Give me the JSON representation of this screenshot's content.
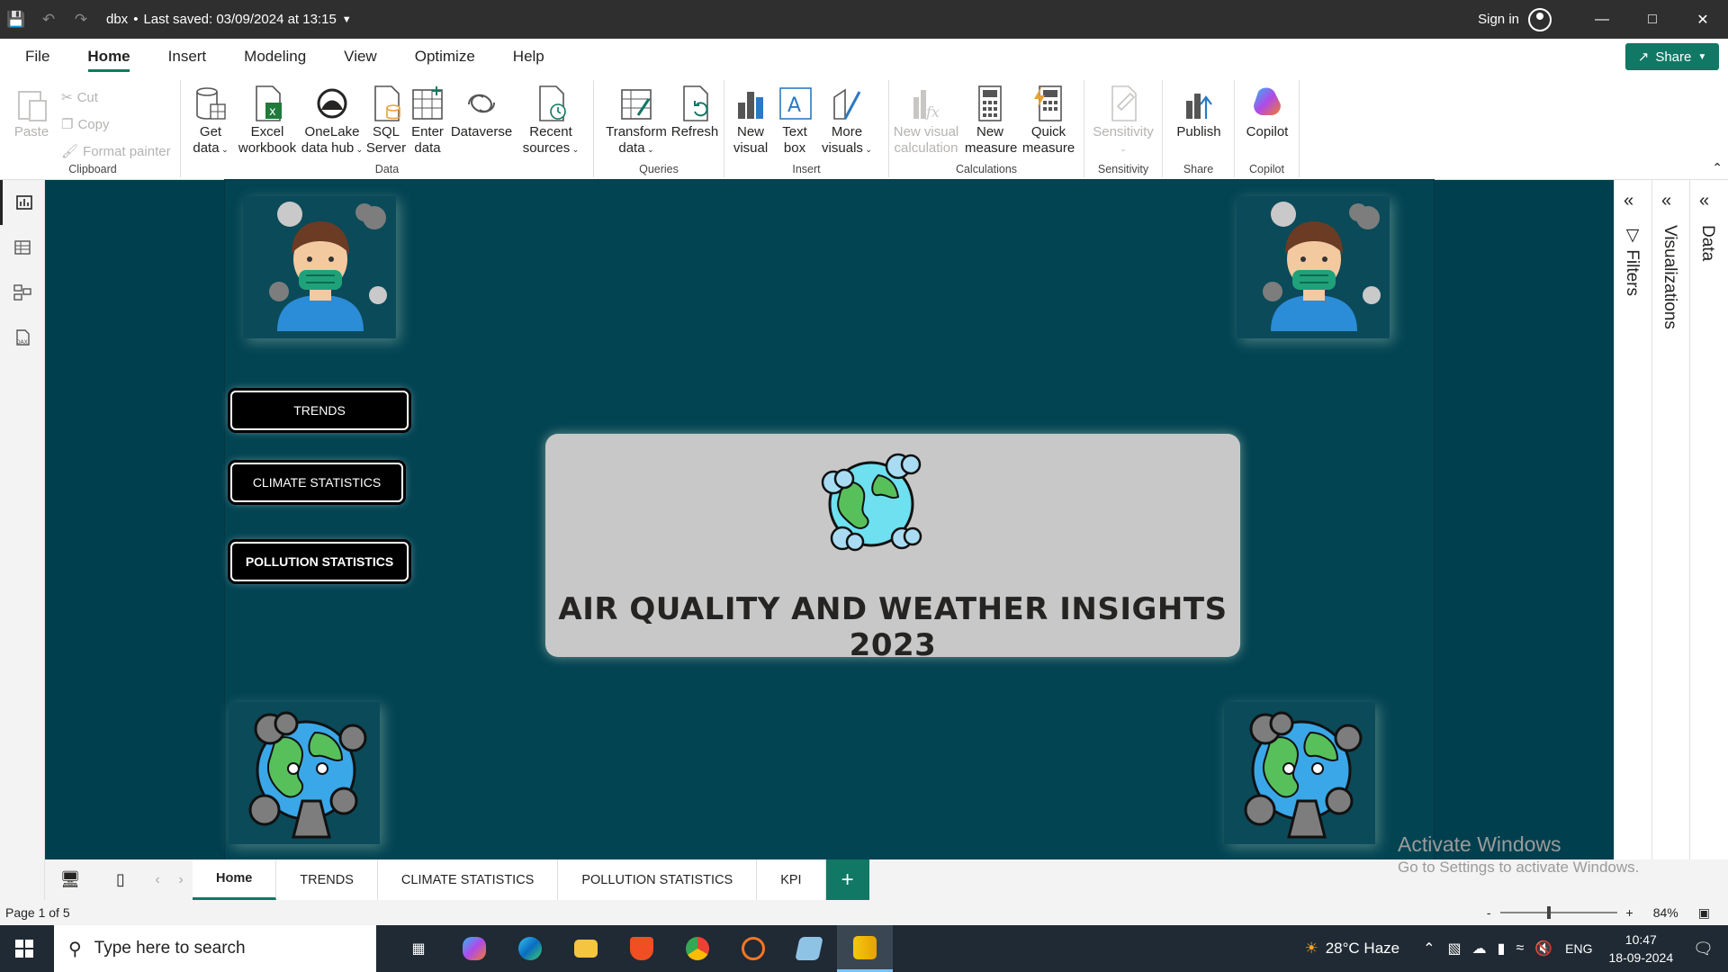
{
  "titlebar": {
    "file_name": "dbx",
    "saved": "Last saved: 03/09/2024 at 13:15",
    "sign_in": "Sign in"
  },
  "menu": {
    "items": [
      "File",
      "Home",
      "Insert",
      "Modeling",
      "View",
      "Optimize",
      "Help"
    ],
    "active": "Home",
    "share": "Share"
  },
  "ribbon": {
    "clipboard": {
      "paste": "Paste",
      "cut": "Cut",
      "copy": "Copy",
      "format_painter": "Format painter",
      "label": "Clipboard"
    },
    "data": {
      "get_data": [
        "Get",
        "data"
      ],
      "excel": [
        "Excel",
        "workbook"
      ],
      "onelake": [
        "OneLake",
        "data hub"
      ],
      "sql": [
        "SQL",
        "Server"
      ],
      "enter": [
        "Enter",
        "data"
      ],
      "dataverse": "Dataverse",
      "recent": [
        "Recent",
        "sources"
      ],
      "label": "Data"
    },
    "queries": {
      "transform": [
        "Transform",
        "data"
      ],
      "refresh": "Refresh",
      "label": "Queries"
    },
    "insert": {
      "new_visual": [
        "New",
        "visual"
      ],
      "text_box": [
        "Text",
        "box"
      ],
      "more_visuals": [
        "More",
        "visuals"
      ],
      "label": "Insert"
    },
    "calculations": {
      "new_visual_calc": [
        "New visual",
        "calculation"
      ],
      "new_measure": [
        "New",
        "measure"
      ],
      "quick_measure": [
        "Quick",
        "measure"
      ],
      "label": "Calculations"
    },
    "sensitivity": {
      "btn": "Sensitivity",
      "label": "Sensitivity"
    },
    "share": {
      "publish": "Publish",
      "label": "Share"
    },
    "copilot": {
      "btn": "Copilot",
      "label": "Copilot"
    }
  },
  "report": {
    "buttons": {
      "trends": "TRENDS",
      "climate": "CLIMATE STATISTICS",
      "pollution": "POLLUTION STATISTICS"
    },
    "title": "AIR QUALITY AND WEATHER INSIGHTS 2023"
  },
  "panes": {
    "filters": "Filters",
    "visualizations": "Visualizations",
    "data": "Data"
  },
  "tabs": [
    "Home",
    "TRENDS",
    "CLIMATE STATISTICS",
    "POLLUTION STATISTICS",
    "KPI"
  ],
  "active_tab": "Home",
  "watermark": {
    "line1": "Activate Windows",
    "line2": "Go to Settings to activate Windows."
  },
  "status": {
    "page": "Page 1 of 5",
    "zoom": "84%",
    "zoom_minus": "-",
    "zoom_plus": "+"
  },
  "taskbar": {
    "search_placeholder": "Type here to search",
    "weather": "28°C  Haze",
    "lang": "ENG",
    "time": "10:47",
    "date": "18-09-2024"
  },
  "colors": {
    "accent": "#117865",
    "canvas": "#003f4e",
    "titlebar": "#2f2f2f"
  }
}
